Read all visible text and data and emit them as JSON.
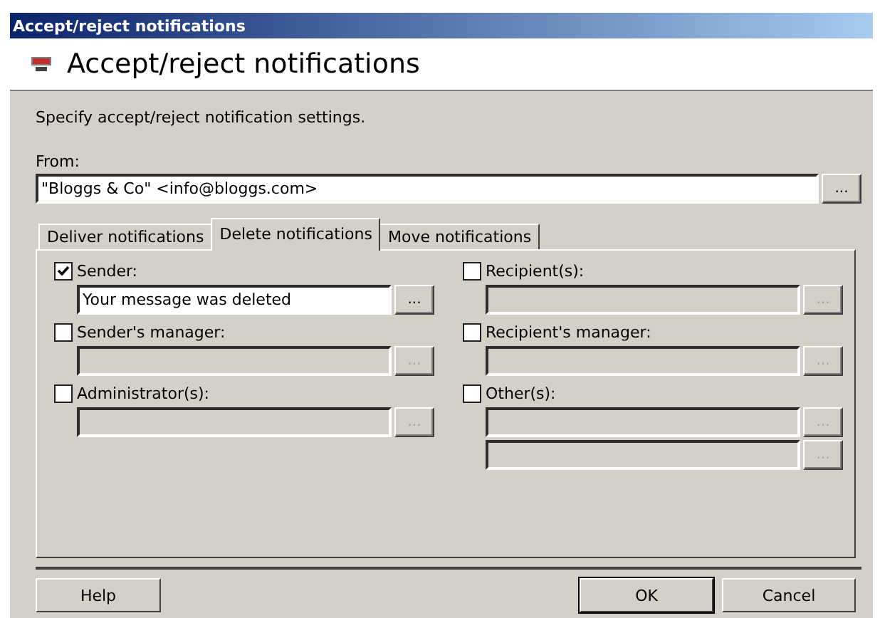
{
  "window": {
    "title": "Accept/reject notifications"
  },
  "header": {
    "title": "Accept/reject notifications"
  },
  "description": "Specify accept/reject notification settings.",
  "from": {
    "label": "From:",
    "value": "\"Bloggs & Co\" <info@bloggs.com>",
    "browse": "..."
  },
  "tabs": [
    {
      "label": "Deliver notifications",
      "selected": false
    },
    {
      "label": "Delete notifications",
      "selected": true
    },
    {
      "label": "Move notifications",
      "selected": false
    }
  ],
  "groups": [
    {
      "label": "Sender:",
      "checked": true,
      "fields": [
        {
          "value": "Your message was deleted",
          "disabled": false,
          "browse": "..."
        }
      ]
    },
    {
      "label": "Recipient(s):",
      "checked": false,
      "fields": [
        {
          "disabled": true,
          "browse": "..."
        }
      ]
    },
    {
      "label": "Sender's manager:",
      "checked": false,
      "fields": [
        {
          "disabled": true,
          "browse": "..."
        }
      ]
    },
    {
      "label": "Recipient's manager:",
      "checked": false,
      "fields": [
        {
          "disabled": true,
          "browse": "..."
        }
      ]
    },
    {
      "label": "Administrator(s):",
      "checked": false,
      "fields": [
        {
          "disabled": true,
          "browse": "..."
        }
      ]
    },
    {
      "label": "Other(s):",
      "checked": false,
      "fields": [
        {
          "disabled": true,
          "browse": "..."
        },
        {
          "disabled": true,
          "browse": "..."
        }
      ]
    }
  ],
  "buttons": [
    {
      "label": "Help",
      "focused": false
    },
    {
      "label": "OK",
      "focused": true
    },
    {
      "label": "Cancel",
      "focused": false
    }
  ]
}
